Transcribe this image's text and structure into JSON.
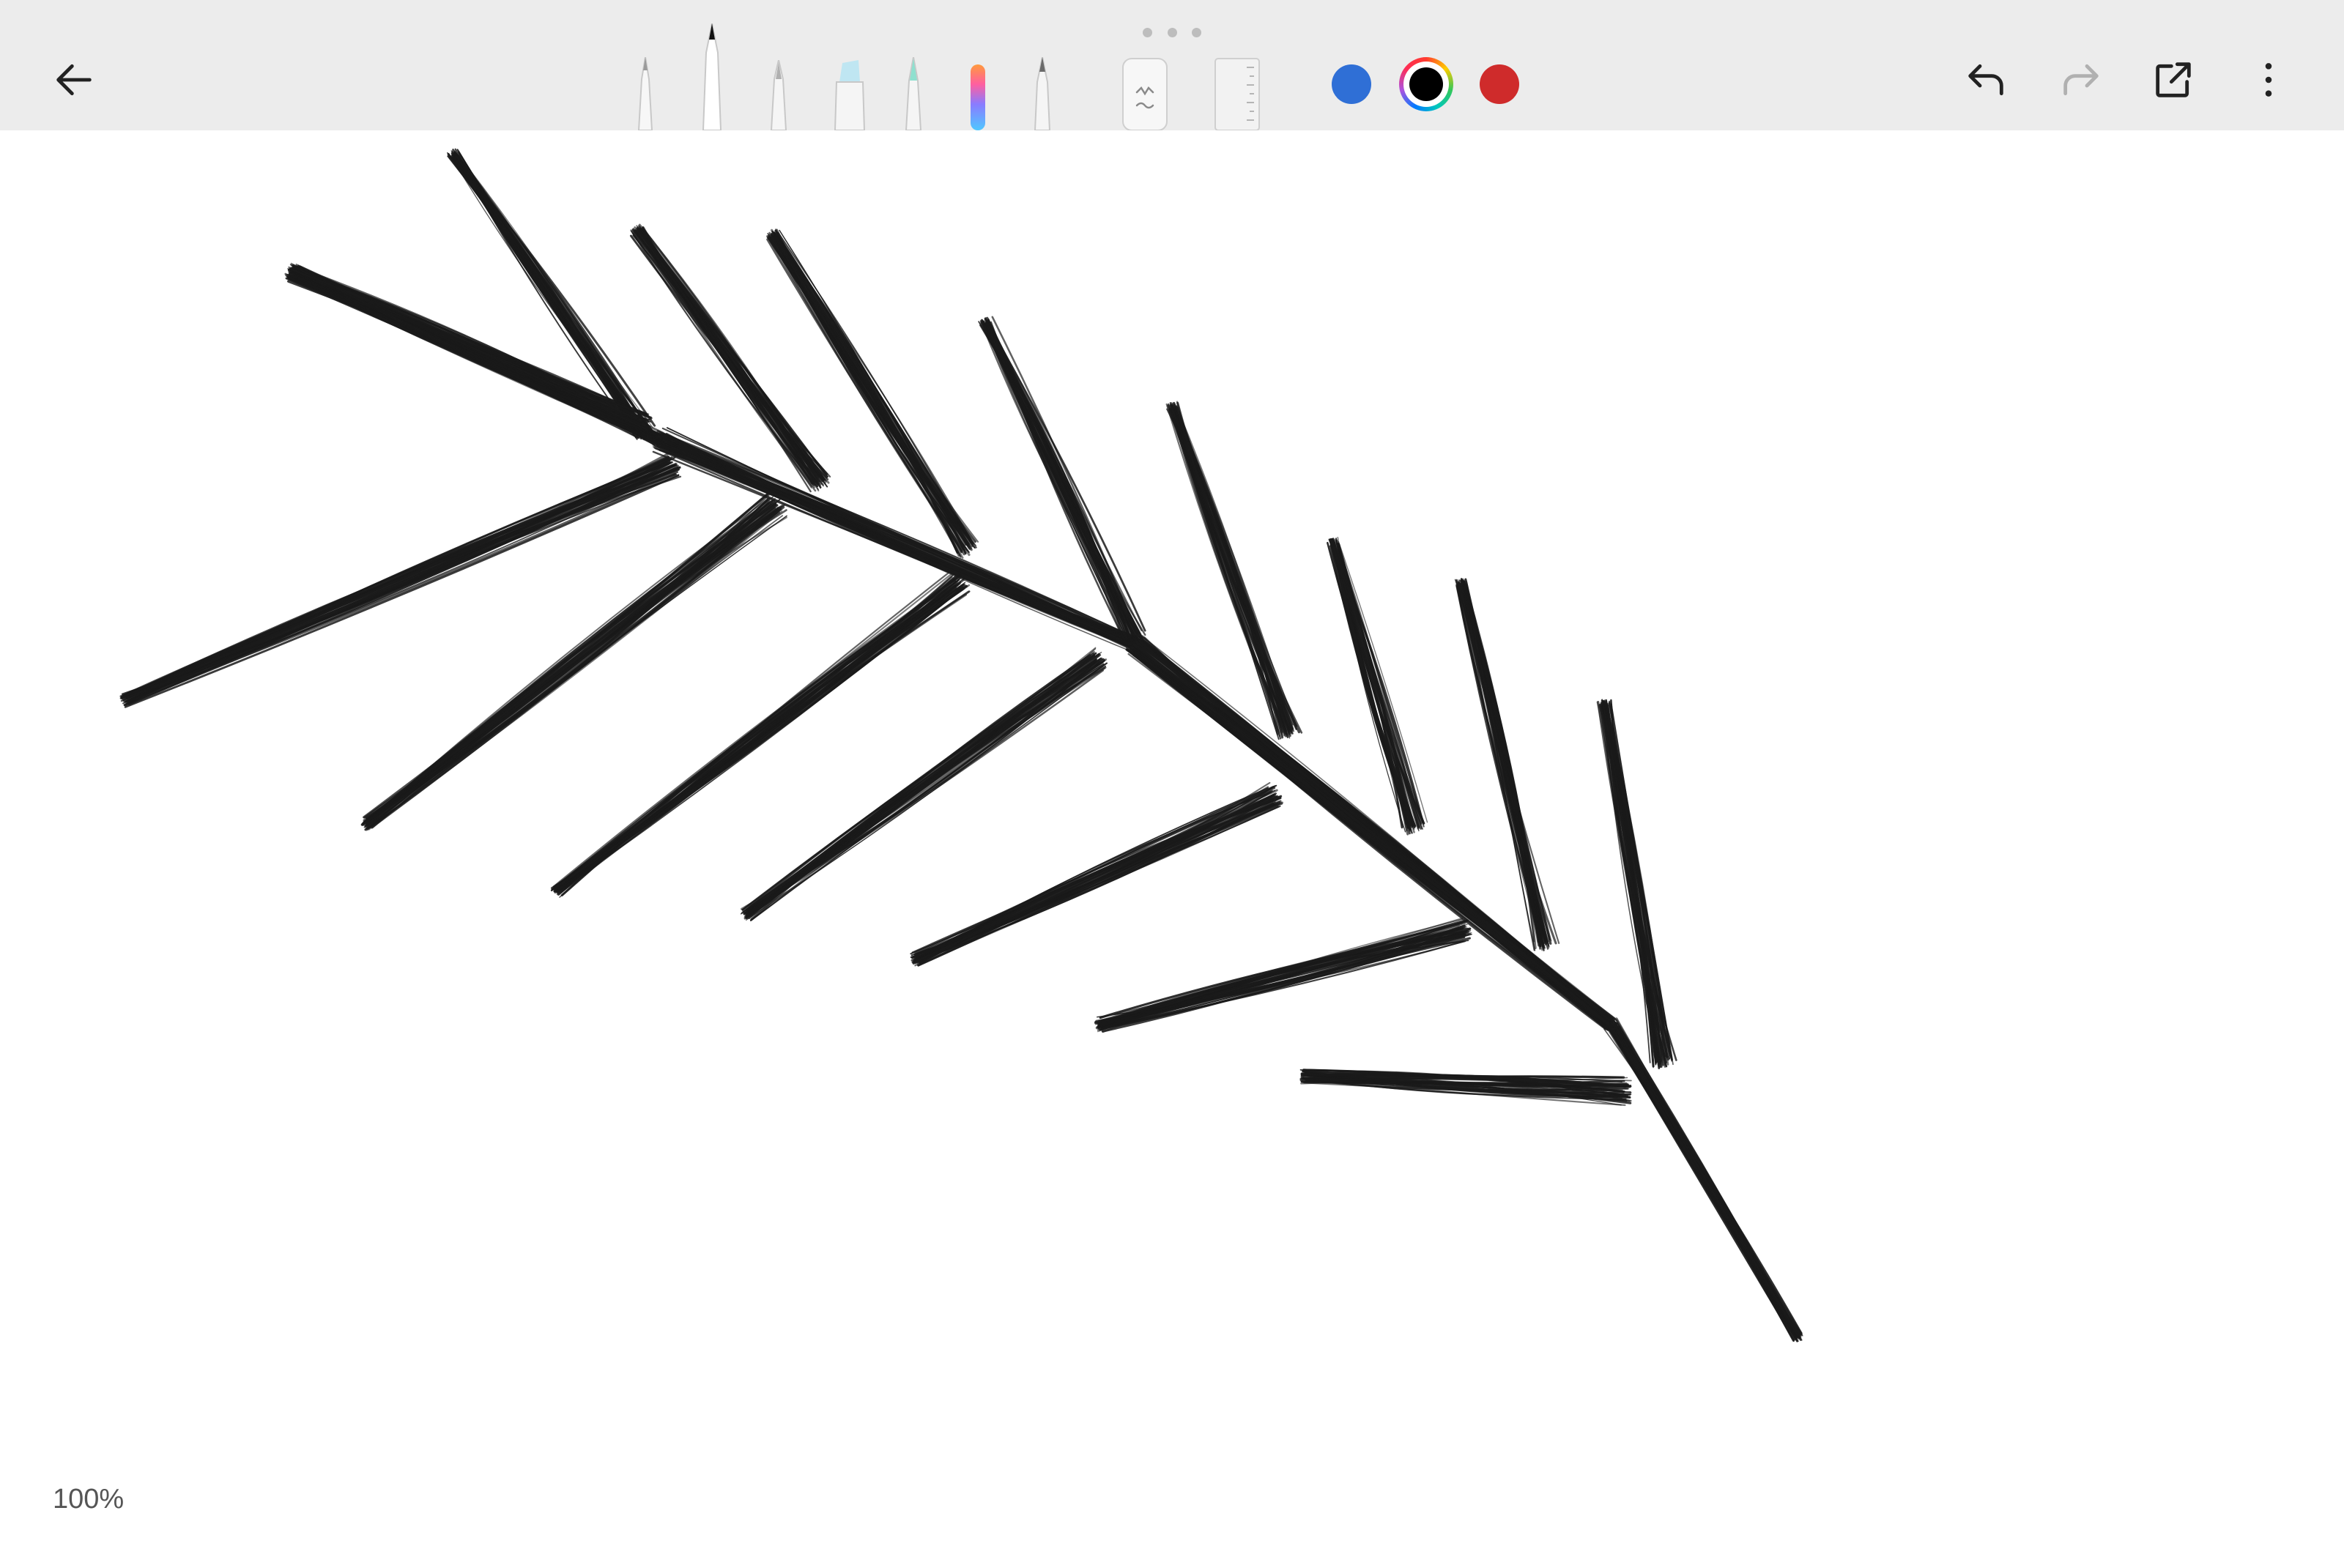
{
  "toolbar": {
    "back_icon": "arrow-left-icon",
    "undo_icon": "undo-icon",
    "redo_icon": "redo-icon",
    "share_icon": "share-external-icon",
    "more_icon": "more-vertical-icon",
    "tools": [
      {
        "name": "fine-pen",
        "selected": false
      },
      {
        "name": "pencil",
        "selected": true
      },
      {
        "name": "fountain-pen",
        "selected": false
      },
      {
        "name": "highlighter",
        "selected": false
      },
      {
        "name": "marker",
        "selected": false
      },
      {
        "name": "rainbow-pen",
        "selected": false
      },
      {
        "name": "calligraphy-pen",
        "selected": false
      },
      {
        "name": "eraser",
        "selected": false
      },
      {
        "name": "ruler",
        "selected": false
      }
    ],
    "colors": [
      {
        "name": "blue",
        "hex": "#2f6fd6",
        "selected": false
      },
      {
        "name": "black",
        "hex": "#000000",
        "selected": true
      },
      {
        "name": "red",
        "hex": "#cf2b2b",
        "selected": false
      }
    ]
  },
  "canvas": {
    "stroke_color": "#1a1a1a",
    "drawing": "fern-leaf-sketch"
  },
  "status": {
    "zoom": "100%"
  }
}
